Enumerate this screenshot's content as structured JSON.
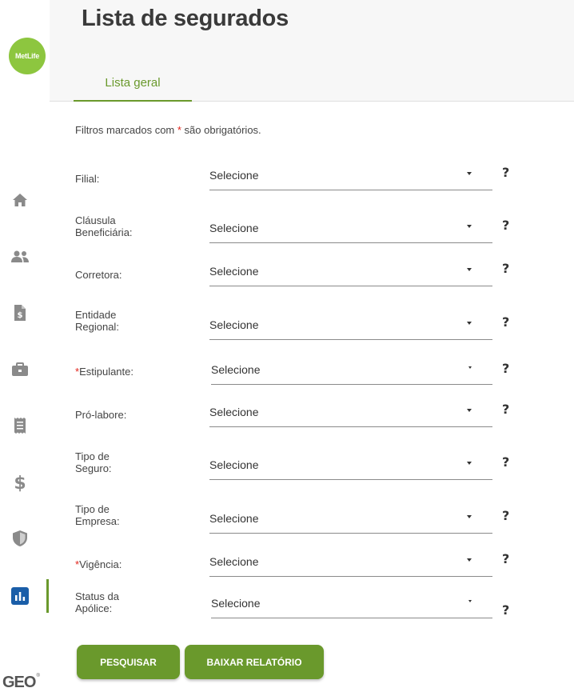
{
  "brand": {
    "logo_text": "MetLife",
    "footer_logo": "GEO",
    "accent": "#6a992c",
    "logo_color": "#8dc63f"
  },
  "sidebar": {
    "items": [
      {
        "icon": "home-icon"
      },
      {
        "icon": "users-icon"
      },
      {
        "icon": "invoice-icon"
      },
      {
        "icon": "briefcase-icon"
      },
      {
        "icon": "receipt-icon"
      },
      {
        "icon": "dollar-icon"
      },
      {
        "icon": "shield-icon"
      },
      {
        "icon": "chart-icon",
        "active": true
      }
    ]
  },
  "header": {
    "title": "Lista de segurados",
    "tabs": [
      {
        "label": "Lista geral",
        "active": true
      }
    ]
  },
  "form": {
    "note_prefix": "Filtros marcados com ",
    "note_star": "*",
    "note_suffix": " são obrigatórios.",
    "required_marker": "*",
    "help_symbol": "?",
    "fields": [
      {
        "label": "Filial:",
        "value": "Selecione"
      },
      {
        "label_line1": "Cláusula",
        "label_line2": "Beneficiária:",
        "value": "Selecione"
      },
      {
        "label": "Corretora:",
        "value": "Selecione"
      },
      {
        "label_line1": "Entidade",
        "label_line2": "Regional:",
        "value": "Selecione"
      },
      {
        "label": "Estipulante:",
        "required": true,
        "value": "Selecione"
      },
      {
        "label": "Pró-labore:",
        "value": "Selecione"
      },
      {
        "label_line1": "Tipo de",
        "label_line2": "Seguro:",
        "value": "Selecione"
      },
      {
        "label_line1": "Tipo de",
        "label_line2": "Empresa:",
        "value": "Selecione"
      },
      {
        "label": "Vigência:",
        "required": true,
        "value": "Selecione"
      },
      {
        "label_line1": "Status da",
        "label_line2": "Apólice:",
        "value": "Selecione"
      }
    ],
    "buttons": {
      "search": "PESQUISAR",
      "download": "BAIXAR RELATÓRIO"
    }
  }
}
